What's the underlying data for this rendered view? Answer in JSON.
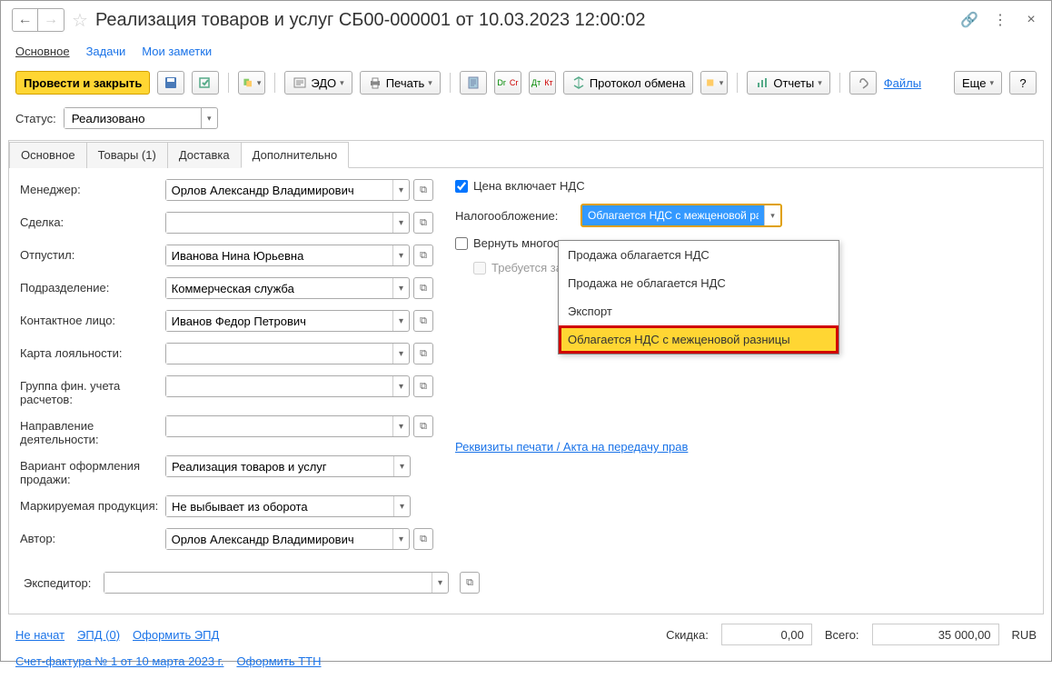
{
  "title": "Реализация товаров и услуг СБ00-000001 от 10.03.2023 12:00:02",
  "topnav": {
    "main": "Основное",
    "tasks": "Задачи",
    "notes": "Мои заметки"
  },
  "toolbar": {
    "post_close": "Провести и закрыть",
    "edo": "ЭДО",
    "print": "Печать",
    "protocol": "Протокол обмена",
    "reports": "Отчеты",
    "files": "Файлы",
    "more": "Еще",
    "help": "?"
  },
  "status": {
    "label": "Статус:",
    "value": "Реализовано"
  },
  "tabs": {
    "main": "Основное",
    "goods": "Товары (1)",
    "delivery": "Доставка",
    "extra": "Дополнительно"
  },
  "fields": {
    "manager": {
      "label": "Менеджер:",
      "value": "Орлов Александр Владимирович"
    },
    "deal": {
      "label": "Сделка:",
      "value": ""
    },
    "released": {
      "label": "Отпустил:",
      "value": "Иванова Нина Юрьевна"
    },
    "dept": {
      "label": "Подразделение:",
      "value": "Коммерческая служба"
    },
    "contact": {
      "label": "Контактное лицо:",
      "value": "Иванов Федор Петрович"
    },
    "loyalty": {
      "label": "Карта лояльности:",
      "value": ""
    },
    "fin_group": {
      "label": "Группа фин. учета расчетов:",
      "value": ""
    },
    "activity": {
      "label": "Направление деятельности:",
      "value": ""
    },
    "variant": {
      "label": "Вариант оформления продажи:",
      "value": "Реализация товаров и услуг"
    },
    "marked": {
      "label": "Маркируемая продукция:",
      "value": "Не выбывает из оборота"
    },
    "author": {
      "label": "Автор:",
      "value": "Орлов Александр Владимирович"
    },
    "expeditor": {
      "label": "Экспедитор:",
      "value": ""
    }
  },
  "right": {
    "vat_included": "Цена включает НДС",
    "tax_label": "Налогообложение:",
    "tax_value": "Облагается НДС с межценовой разни",
    "return_reusable": "Вернуть многоо",
    "require_deposit": "Требуется за",
    "print_req": "Реквизиты печати / Акта на передачу прав"
  },
  "dropdown": {
    "opt1": "Продажа облагается НДС",
    "opt2": "Продажа не облагается НДС",
    "opt3": "Экспорт",
    "opt4": "Облагается НДС с межценовой разницы"
  },
  "footer": {
    "not_started": "Не начат",
    "epd": "ЭПД (0)",
    "epd_create": "Оформить ЭПД",
    "discount_label": "Скидка:",
    "discount_value": "0,00",
    "total_label": "Всего:",
    "total_value": "35 000,00",
    "currency": "RUB",
    "invoice": "Счет-фактура № 1 от 10 марта 2023 г.",
    "ttn": "Оформить ТТН"
  }
}
